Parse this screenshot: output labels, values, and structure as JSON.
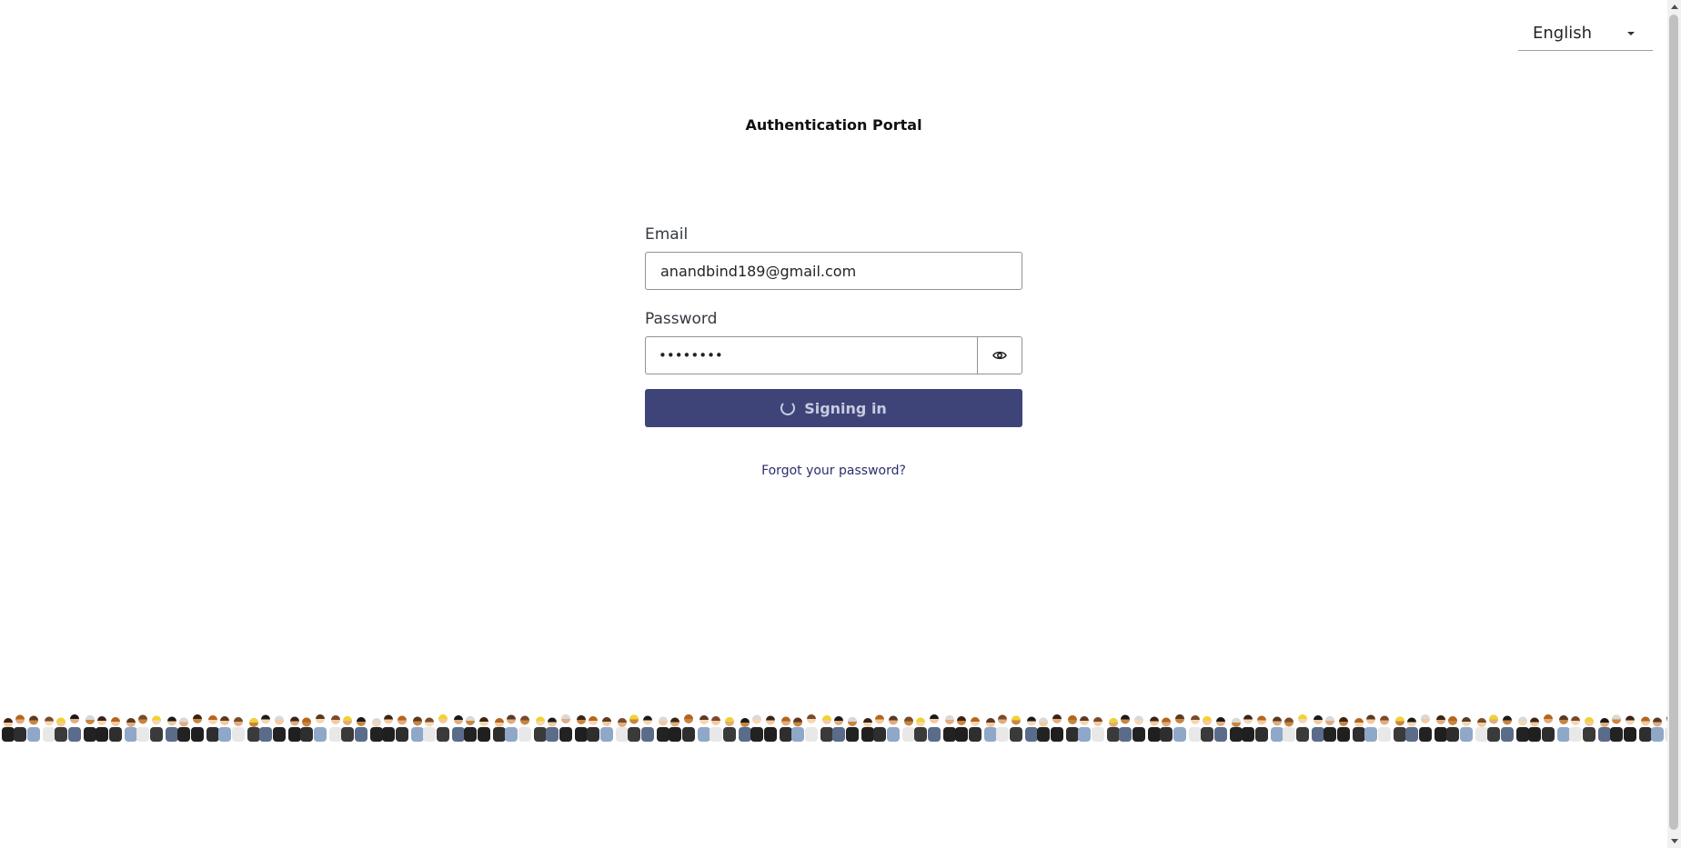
{
  "language": {
    "selected": "English",
    "icon": "chevron-down-icon"
  },
  "title": "Authentication Portal",
  "form": {
    "email_label": "Email",
    "email_value": "anandbind189@gmail.com",
    "password_label": "Password",
    "password_value": "••••••••",
    "show_password_icon": "eye-icon",
    "submit_label": "Signing in",
    "submit_icon": "spinner-icon",
    "forgot_label": "Forgot your password?"
  },
  "colors": {
    "primary_button": "#3f4478",
    "link": "#2b2f6b"
  }
}
